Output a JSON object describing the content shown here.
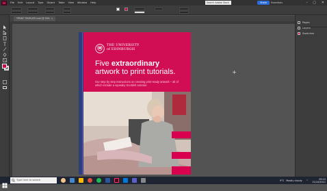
{
  "app": {
    "logo_text": "Id",
    "menu": [
      "File",
      "Edit",
      "Layout",
      "Type",
      "Object",
      "Table",
      "View",
      "Window",
      "Help"
    ],
    "share_label": "Share",
    "workspace_label": "Essentials Classic",
    "search_placeholder": "Search Adobe Stock",
    "window_controls": [
      "–",
      "▢",
      "✕"
    ]
  },
  "document": {
    "tab_label": "*PRINT TEMPLATE.indd @ 59%",
    "tab_close": "×"
  },
  "artwork": {
    "university_line1": "THE UNIVERSITY",
    "university_line2": "of EDINBURGH",
    "headline_prefix": "Five ",
    "headline_bold": "extraordinary",
    "headline_line2": "artwork to print tutorials.",
    "subtext": "Our step by step instructions on creating print-ready artwork – all of which include a squeaky Scottish narrator.",
    "colors": {
      "brand_pink": "#d10e54",
      "bleed_blue": "#2c3f7a"
    }
  },
  "panels": {
    "items": [
      {
        "label": "Pages",
        "icon": "pages-icon"
      },
      {
        "label": "Layers",
        "icon": "layers-icon"
      },
      {
        "label": "Swatches",
        "icon": "swatches-icon"
      }
    ]
  },
  "status": {
    "text": ""
  },
  "taskbar": {
    "search_placeholder": "Type here to search",
    "weather": "Mostly cloudy",
    "temp": "9°C",
    "time": "09:15",
    "date": "21/10/2021"
  }
}
